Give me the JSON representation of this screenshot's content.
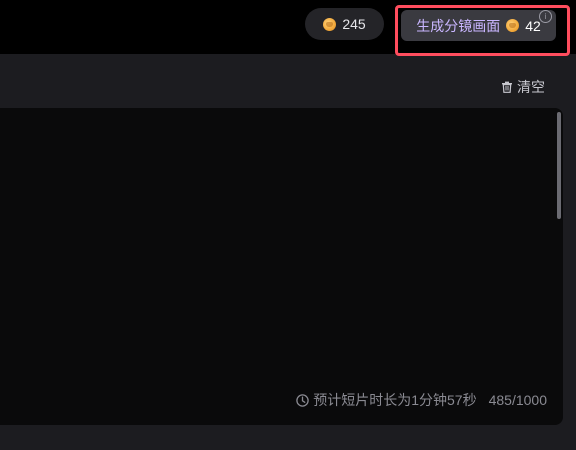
{
  "header": {
    "credits": "245",
    "generate_button": {
      "label": "生成分镜画面",
      "cost": "42"
    }
  },
  "toolbar": {
    "clear_label": "清空"
  },
  "editor": {
    "estimate_text": "预计短片时长为1分钟57秒",
    "char_count": "485/1000"
  },
  "icons": {
    "coin": "coin-icon",
    "info": "info-icon",
    "trash": "trash-icon",
    "clock": "clock-icon"
  },
  "colors": {
    "highlight_border": "#ff4d5e",
    "button_text": "#c9b6ff",
    "background": "#1c1c20",
    "editor_bg": "#0a0a0b"
  }
}
